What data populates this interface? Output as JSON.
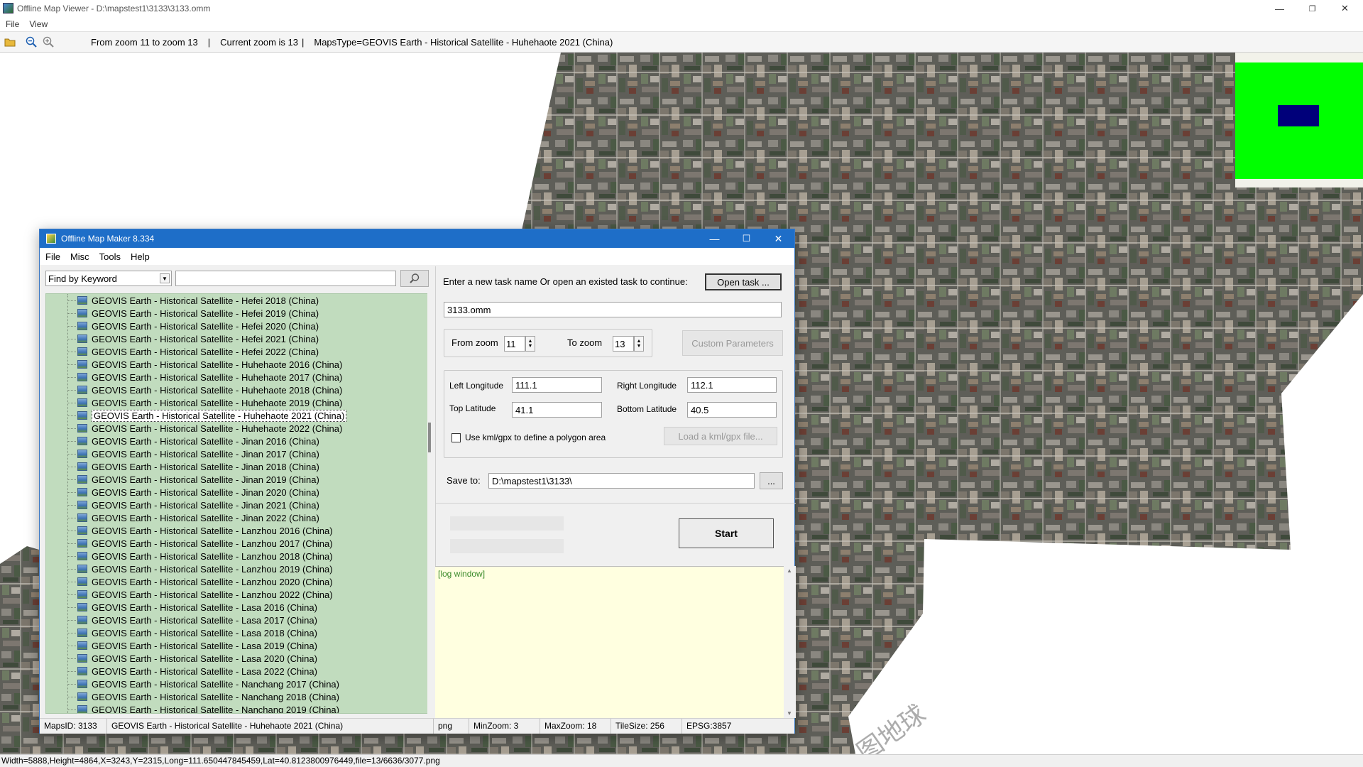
{
  "viewer": {
    "title": "Offline Map Viewer - D:\\mapstest1\\3133\\3133.omm",
    "menu": [
      "File",
      "View"
    ],
    "toolbar": {
      "zoom_range": "From zoom 11 to zoom 13",
      "sep1": "|",
      "current_zoom": "Current zoom is 13",
      "sep2": "|",
      "maps_type": "MapsType=GEOVIS Earth - Historical Satellite - Huhehaote 2021 (China)"
    },
    "watermark": "图地球",
    "status": "Width=5888,Height=4864,X=3243,Y=2315,Long=111.650447845459,Lat=40.8123800976449,file=13/6636/3077.png",
    "overview_colors": {
      "background": "#00ff00",
      "viewport": "#00007a"
    }
  },
  "dialog": {
    "title": "Offline Map Maker 8.334",
    "menu": [
      "File",
      "Misc",
      "Tools",
      "Help"
    ],
    "search": {
      "mode": "Find by Keyword",
      "query": ""
    },
    "tree_items": [
      "GEOVIS Earth - Historical Satellite - Hefei 2018 (China)",
      "GEOVIS Earth - Historical Satellite - Hefei 2019 (China)",
      "GEOVIS Earth - Historical Satellite - Hefei 2020 (China)",
      "GEOVIS Earth - Historical Satellite - Hefei 2021 (China)",
      "GEOVIS Earth - Historical Satellite - Hefei 2022 (China)",
      "GEOVIS Earth - Historical Satellite - Huhehaote 2016 (China)",
      "GEOVIS Earth - Historical Satellite - Huhehaote 2017 (China)",
      "GEOVIS Earth - Historical Satellite - Huhehaote 2018 (China)",
      "GEOVIS Earth - Historical Satellite - Huhehaote 2019 (China)",
      "GEOVIS Earth - Historical Satellite - Huhehaote 2021 (China)",
      "GEOVIS Earth - Historical Satellite - Huhehaote 2022 (China)",
      "GEOVIS Earth - Historical Satellite - Jinan 2016 (China)",
      "GEOVIS Earth - Historical Satellite - Jinan 2017 (China)",
      "GEOVIS Earth - Historical Satellite - Jinan 2018 (China)",
      "GEOVIS Earth - Historical Satellite - Jinan 2019 (China)",
      "GEOVIS Earth - Historical Satellite - Jinan 2020 (China)",
      "GEOVIS Earth - Historical Satellite - Jinan 2021 (China)",
      "GEOVIS Earth - Historical Satellite - Jinan 2022 (China)",
      "GEOVIS Earth - Historical Satellite - Lanzhou 2016 (China)",
      "GEOVIS Earth - Historical Satellite - Lanzhou 2017 (China)",
      "GEOVIS Earth - Historical Satellite - Lanzhou 2018 (China)",
      "GEOVIS Earth - Historical Satellite - Lanzhou 2019 (China)",
      "GEOVIS Earth - Historical Satellite - Lanzhou 2020 (China)",
      "GEOVIS Earth - Historical Satellite - Lanzhou 2022 (China)",
      "GEOVIS Earth - Historical Satellite - Lasa 2016 (China)",
      "GEOVIS Earth - Historical Satellite - Lasa 2017 (China)",
      "GEOVIS Earth - Historical Satellite - Lasa 2018 (China)",
      "GEOVIS Earth - Historical Satellite - Lasa 2019 (China)",
      "GEOVIS Earth - Historical Satellite - Lasa 2020 (China)",
      "GEOVIS Earth - Historical Satellite - Lasa 2022 (China)",
      "GEOVIS Earth - Historical Satellite - Nanchang 2017 (China)",
      "GEOVIS Earth - Historical Satellite - Nanchang 2018 (China)",
      "GEOVIS Earth - Historical Satellite - Nanchang 2019 (China)"
    ],
    "selected_index": 9,
    "task": {
      "prompt": "Enter a new task name Or open an existed task to continue:",
      "open_label": "Open task ...",
      "name": "3133.omm"
    },
    "zoom": {
      "from_label": "From zoom",
      "from_value": "11",
      "to_label": "To zoom",
      "to_value": "13",
      "custom_label": "Custom Parameters"
    },
    "area": {
      "left_lon_label": "Left Longitude",
      "left_lon": "111.1",
      "right_lon_label": "Right Longitude",
      "right_lon": "112.1",
      "top_lat_label": "Top Latitude",
      "top_lat": "41.1",
      "bottom_lat_label": "Bottom Latitude",
      "bottom_lat": "40.5",
      "kml_label": "Use kml/gpx to define a polygon area",
      "load_kml_label": "Load a kml/gpx file..."
    },
    "save": {
      "label": "Save to:",
      "path": "D:\\mapstest1\\3133\\",
      "browse": "..."
    },
    "start_label": "Start",
    "log_label": "[log window]",
    "status": {
      "maps_id": "MapsID: 3133",
      "maps_name": "GEOVIS Earth - Historical Satellite - Huhehaote 2021 (China)",
      "format": "png",
      "min_zoom": "MinZoom: 3",
      "max_zoom": "MaxZoom: 18",
      "tile_size": "TileSize: 256",
      "epsg": "EPSG:3857"
    }
  }
}
